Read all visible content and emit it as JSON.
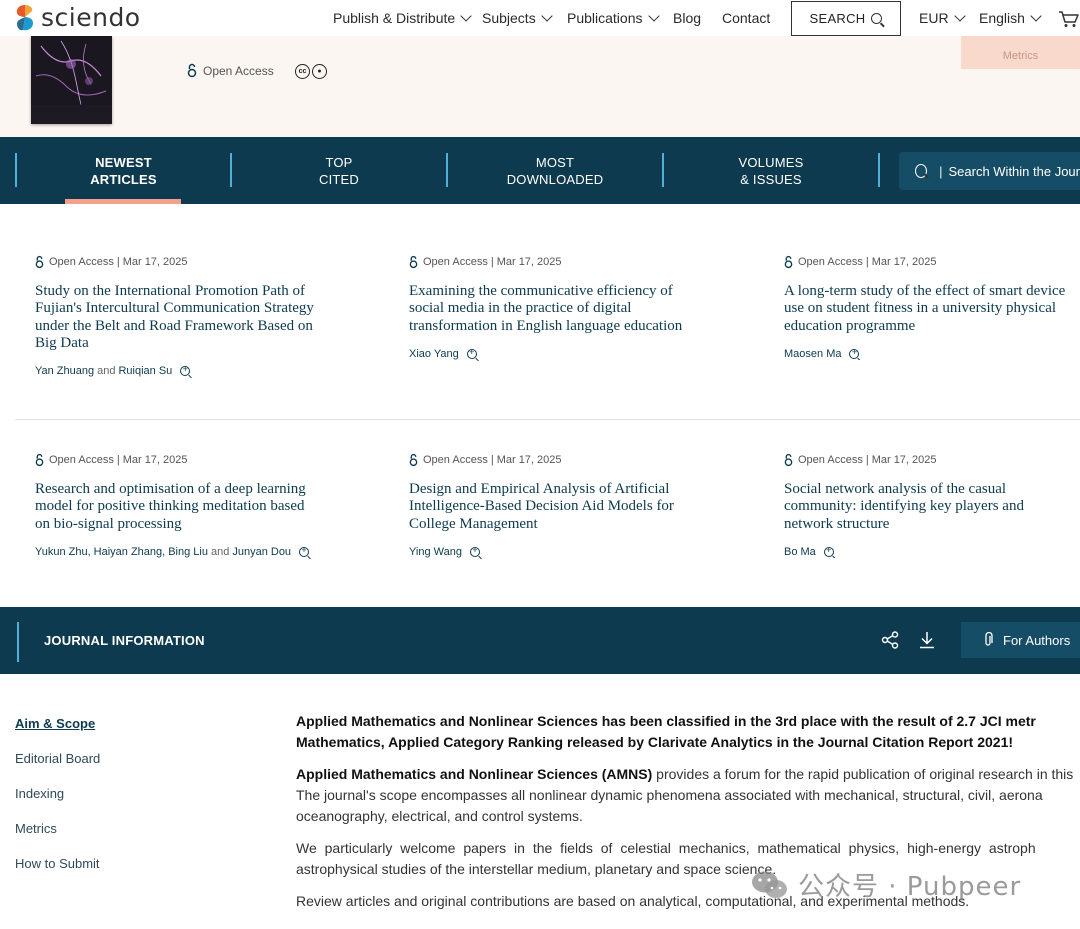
{
  "header": {
    "logo_text": "sciendo",
    "nav": [
      {
        "label": "Publish & Distribute",
        "dropdown": true
      },
      {
        "label": "Subjects",
        "dropdown": true
      },
      {
        "label": "Publications",
        "dropdown": true
      },
      {
        "label": "Blog",
        "dropdown": false
      },
      {
        "label": "Contact",
        "dropdown": false
      }
    ],
    "search_label": "SEARCH",
    "currency": "EUR",
    "language": "English"
  },
  "hero": {
    "open_access_label": "Open Access",
    "metrics_tab_label": "Metrics",
    "license_icons": [
      "cc-icon",
      "by-icon"
    ]
  },
  "tabs": [
    {
      "line1": "NEWEST",
      "line2": "ARTICLES",
      "active": true
    },
    {
      "line1": "TOP",
      "line2": "CITED",
      "active": false
    },
    {
      "line1": "MOST",
      "line2": "DOWNLOADED",
      "active": false
    },
    {
      "line1": "VOLUMES",
      "line2": "& ISSUES",
      "active": false
    }
  ],
  "tab_search_placeholder": "Search Within the Jour",
  "articles": [
    {
      "access": "Open Access",
      "date": "Mar 17, 2025",
      "title_lines": [
        "Study on the International Promotion Path of",
        "Fujian's Intercultural Communication Strategy",
        "under the Belt and Road Framework Based on",
        "Big Data"
      ],
      "authors": [
        "Yan Zhuang",
        "Ruiqian Su"
      ]
    },
    {
      "access": "Open Access",
      "date": "Mar 17, 2025",
      "title_lines": [
        "Examining the communicative efficiency of",
        "social media in the practice of digital",
        "transformation in English language education"
      ],
      "authors": [
        "Xiao Yang"
      ]
    },
    {
      "access": "Open Access",
      "date": "Mar 17, 2025",
      "title_lines": [
        "A long-term study of the effect of smart device",
        "use on student fitness in a university physical",
        "education programme"
      ],
      "authors": [
        "Maosen Ma"
      ]
    },
    {
      "access": "Open Access",
      "date": "Mar 17, 2025",
      "title_lines": [
        "Research and optimisation of a deep learning",
        "model for positive thinking meditation based",
        "on bio-signal processing"
      ],
      "authors": [
        "Yukun Zhu",
        "Haiyan Zhang",
        "Bing Liu",
        "Junyan Dou"
      ]
    },
    {
      "access": "Open Access",
      "date": "Mar 17, 2025",
      "title_lines": [
        "Design and Empirical Analysis of Artificial",
        "Intelligence-Based Decision Aid Models for",
        "College Management"
      ],
      "authors": [
        "Ying Wang"
      ]
    },
    {
      "access": "Open Access",
      "date": "Mar 17, 2025",
      "title_lines": [
        "Social network analysis of the casual",
        "community: identifying key players and",
        "network structure"
      ],
      "authors": [
        "Bo Ma"
      ]
    }
  ],
  "authors_and": "and",
  "journal_info": {
    "title": "JOURNAL INFORMATION",
    "for_authors": "For Authors"
  },
  "sidebar": [
    {
      "label": "Aim & Scope",
      "active": true
    },
    {
      "label": "Editorial Board",
      "active": false
    },
    {
      "label": "Indexing",
      "active": false
    },
    {
      "label": "Metrics",
      "active": false
    },
    {
      "label": "How to Submit",
      "active": false
    }
  ],
  "content": {
    "p1_lines": [
      "Applied Mathematics and Nonlinear Sciences has been classified in the 3rd place with the result of 2.7 JCI metr",
      "Mathematics, Applied Category Ranking released by Clarivate Analytics in the Journal Citation Report 2021!"
    ],
    "p2_bold": "Applied Mathematics and Nonlinear Sciences (AMNS)",
    "p2_line1_rest": " provides a forum for the rapid publication of original research in this",
    "p2_line2": "The journal's scope encompasses all nonlinear dynamic phenomena associated with mechanical, structural, civil, aerona",
    "p2_line3": "oceanography, electrical, and control systems.",
    "p3_line1": "We particularly welcome papers in the fields of celestial mechanics, mathematical physics, high-energy astroph",
    "p3_line2": "astrophysical studies of the interstellar medium, planetary and space science.",
    "p4": "Review articles and original contributions are based on analytical, computational, and experimental methods."
  },
  "watermark": "公众号 · Pubpeer",
  "colors": {
    "navy": "#0d3a4e",
    "accent_blue": "#4fb0d8",
    "salmon": "#f3a18b",
    "hero_bg": "#fcf6f2"
  }
}
